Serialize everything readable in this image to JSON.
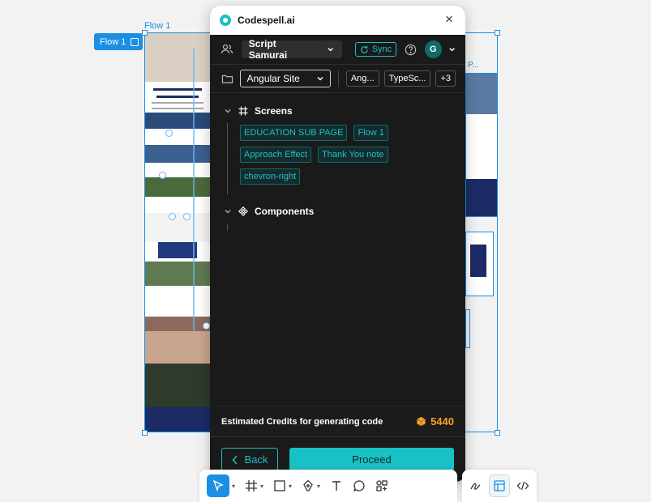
{
  "canvas": {
    "frame_label": "Flow 1",
    "flow_chip_label": "Flow 1",
    "right_frame_label": "P..."
  },
  "panel": {
    "title": "Codespell.ai",
    "workspace": "Script Samurai",
    "sync_label": "Sync",
    "avatar_initial": "G",
    "framework": "Angular Site",
    "tags": [
      "Ang...",
      "TypeSc...",
      "+3"
    ],
    "screens": {
      "title": "Screens",
      "items": [
        "EDUCATION SUB PAGE",
        "Flow 1",
        "Approach Effect",
        "Thank You note",
        "chevron-right"
      ]
    },
    "components": {
      "title": "Components"
    },
    "credits": {
      "label": "Estimated Credits for generating code",
      "value": "5440"
    },
    "back_label": "Back",
    "proceed_label": "Proceed"
  },
  "colors": {
    "accent": "#18c1c4",
    "selection": "#1a8fe3",
    "credits": "#f4a326",
    "panel_bg": "#1a1a1a"
  }
}
